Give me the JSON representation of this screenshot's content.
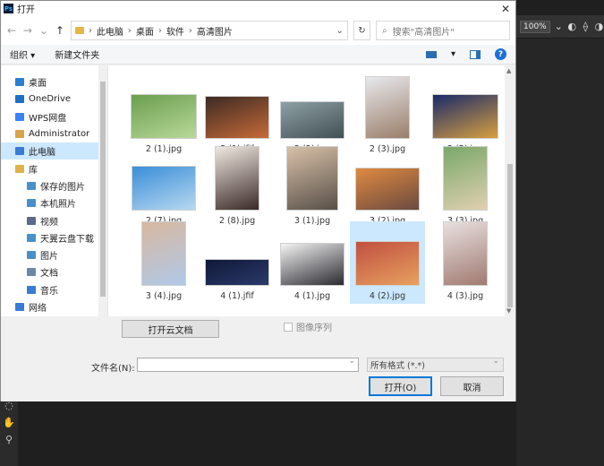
{
  "window": {
    "title": "打开",
    "app_badge": "Ps"
  },
  "nav": {
    "back": "←",
    "forward": "→",
    "up": "↑"
  },
  "breadcrumb": [
    "此电脑",
    "桌面",
    "软件",
    "高清图片"
  ],
  "search": {
    "placeholder": "搜索\"高清图片\""
  },
  "toolbar": {
    "organize": "组织 ▾",
    "new_folder": "新建文件夹",
    "help": "?"
  },
  "sidebar": [
    {
      "label": "桌面",
      "level": 1,
      "icon": "desktop-icon",
      "color": "#2a7fd4"
    },
    {
      "label": "OneDrive",
      "level": 1,
      "icon": "cloud-icon",
      "color": "#1f6fc5"
    },
    {
      "label": "WPS网盘",
      "level": 1,
      "icon": "cloud-icon",
      "color": "#3b82f6"
    },
    {
      "label": "Administrator",
      "level": 1,
      "icon": "user-icon",
      "color": "#d6a54a"
    },
    {
      "label": "此电脑",
      "level": 1,
      "icon": "computer-icon",
      "color": "#3a7bd5",
      "selected": true
    },
    {
      "label": "库",
      "level": 1,
      "icon": "library-icon",
      "color": "#e0b24d"
    },
    {
      "label": "保存的图片",
      "level": 2,
      "icon": "pictures-icon",
      "color": "#4a90c8"
    },
    {
      "label": "本机照片",
      "level": 2,
      "icon": "pictures-icon",
      "color": "#4a90c8"
    },
    {
      "label": "视频",
      "level": 2,
      "icon": "video-icon",
      "color": "#5a6a8a"
    },
    {
      "label": "天翼云盘下载",
      "level": 2,
      "icon": "download-icon",
      "color": "#4a90c8"
    },
    {
      "label": "图片",
      "level": 2,
      "icon": "pictures-icon",
      "color": "#4a90c8"
    },
    {
      "label": "文档",
      "level": 2,
      "icon": "document-icon",
      "color": "#6c88a8"
    },
    {
      "label": "音乐",
      "level": 2,
      "icon": "music-icon",
      "color": "#3a7bd5"
    },
    {
      "label": "网络",
      "level": 1,
      "icon": "network-icon",
      "color": "#3a7bd5"
    }
  ],
  "files": [
    {
      "name": "2 (1).jpg",
      "colors": [
        "#6a9e4e",
        "#b9d99a"
      ]
    },
    {
      "name": "2 (1).jfif",
      "colors": [
        "#3c2a24",
        "#c86a38"
      ]
    },
    {
      "name": "2 (2).jpg",
      "colors": [
        "#8fa0a5",
        "#405055"
      ]
    },
    {
      "name": "2 (3).jpg",
      "colors": [
        "#e8e8ec",
        "#9a7e6a"
      ]
    },
    {
      "name": "2 (5).jpg",
      "colors": [
        "#1a2a6a",
        "#d8a040"
      ]
    },
    {
      "name": "2 (7).jpg",
      "colors": [
        "#3a8ed8",
        "#b8d8f0"
      ]
    },
    {
      "name": "2 (8).jpg",
      "colors": [
        "#f0e8e0",
        "#3a2a28"
      ]
    },
    {
      "name": "3 (1).jpg",
      "colors": [
        "#d8c0a8",
        "#585048"
      ]
    },
    {
      "name": "3 (2).jpg",
      "colors": [
        "#e08a40",
        "#6a4a40"
      ]
    },
    {
      "name": "3 (3).jpg",
      "colors": [
        "#7aa86a",
        "#e0d0b0"
      ]
    },
    {
      "name": "3 (4).jpg",
      "colors": [
        "#d8b8a0",
        "#b0c8e8"
      ]
    },
    {
      "name": "4 (1).jfif",
      "colors": [
        "#101838",
        "#2a3a6a"
      ]
    },
    {
      "name": "4 (1).jpg",
      "colors": [
        "#f4f4f4",
        "#2a2a30"
      ]
    },
    {
      "name": "4 (2).jpg",
      "colors": [
        "#c05040",
        "#e8a060"
      ],
      "selected": true
    },
    {
      "name": "4 (3).jpg",
      "colors": [
        "#e8e0e0",
        "#a07a70"
      ]
    }
  ],
  "bottom": {
    "open_cloud": "打开云文档",
    "image_sequence": "图像序列",
    "filename_label": "文件名(N):",
    "filename_value": "",
    "filter": "所有格式 (*.*)",
    "open": "打开(O)",
    "cancel": "取消"
  },
  "photoshop": {
    "zoom": "100%"
  }
}
